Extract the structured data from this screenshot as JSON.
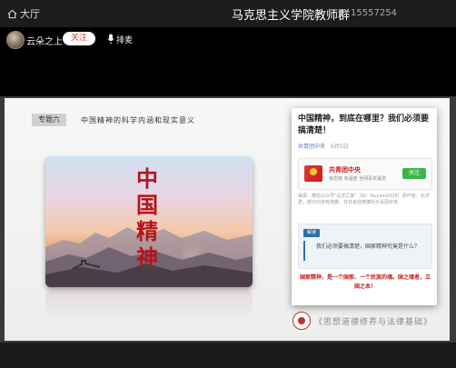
{
  "topbar": {
    "home_label": "大厅",
    "room_title": "马克思主义学院教师群",
    "room_id": "ID:15557254"
  },
  "host": {
    "name": "云朵之上",
    "follow_label": "关注",
    "mic_label": "排麦"
  },
  "slide": {
    "topic_tag": "专题六",
    "topic_title": "中国精神的科学内涵和现实意义",
    "poster_title": "中国精神",
    "article": {
      "title": "中国精神，到底在哪里？我们必须要搞清楚！",
      "author": "共青团中央",
      "date": "6月5日",
      "account_name": "共青团中央",
      "account_desc": "有态度 有温度 全网青年最爱",
      "account_follow": "关注",
      "source_text": "来源：微信公众号\"北洋之家\"（ID：buyxm2018）原作者：北洋君，部分内容有增删，并非来自微博补外青团中央",
      "quiz_tag": "解读",
      "quiz_text": "我们必须要搞清楚，国家精神究竟是什么？",
      "answer_text": "国家精神，是一个国家、一个民族的魂。国之魂者，立国之本！"
    },
    "seal_caption": "《思想道德修养与法律基础》"
  },
  "colors": {
    "follow_text": "#e0403a",
    "accent_red": "#c41e1e",
    "wechat_green": "#3bb54a"
  }
}
